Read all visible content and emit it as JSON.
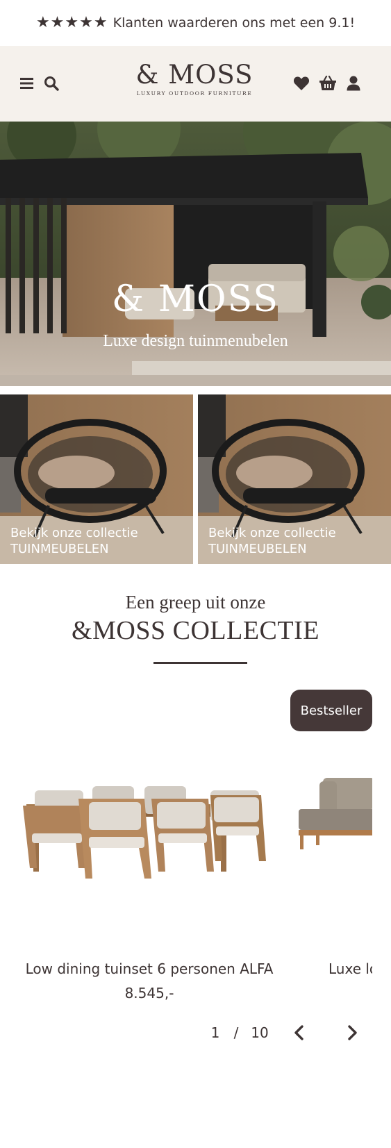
{
  "review_bar": {
    "rating_stars": 5,
    "text": "Klanten waarderen ons met een 9.1!"
  },
  "header": {
    "menu_icon": "hamburger-icon",
    "search_icon": "search-icon",
    "logo_text": "& MOSS",
    "logo_tagline": "LUXURY OUTDOOR FURNITURE",
    "wishlist_icon": "heart-icon",
    "cart_icon": "basket-icon",
    "account_icon": "user-icon"
  },
  "hero": {
    "title": "& MOSS",
    "subtitle": "Luxe design tuinmenubelen"
  },
  "collections": [
    {
      "line1": "Bekijk onze collectie",
      "line2": "TUINMEUBELEN"
    },
    {
      "line1": "Bekijk onze collectie",
      "line2": "TUINMEUBELEN"
    }
  ],
  "section": {
    "pre_title": "Een greep uit onze",
    "title": "&MOSS COLLECTIE"
  },
  "products": [
    {
      "badge": "Bestseller",
      "name": "Low dining tuinset 6 personen ALFA",
      "price": "8.545,-"
    },
    {
      "name": "Luxe lo"
    }
  ],
  "pagination": {
    "current": "1",
    "separator": "/",
    "total": "10",
    "prev_icon": "chevron-left-icon",
    "next_icon": "chevron-right-icon"
  },
  "colors": {
    "brand_dark": "#3d3434",
    "header_bg": "#f5f1ec",
    "badge_bg": "#453838"
  }
}
